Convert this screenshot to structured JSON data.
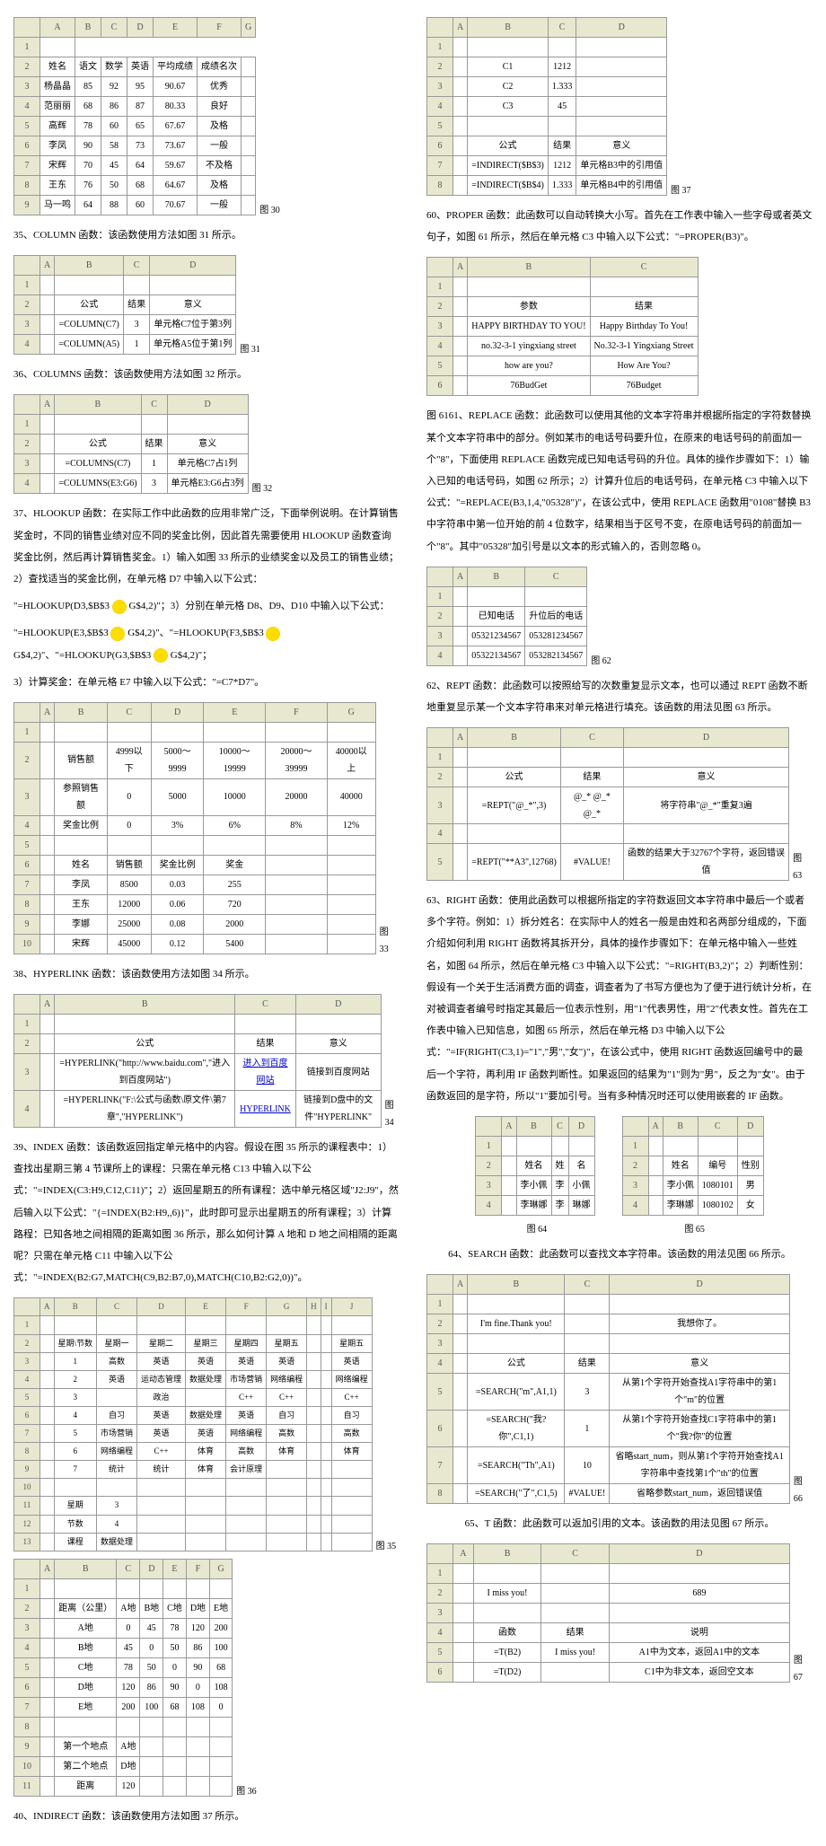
{
  "left": {
    "fig30": {
      "cols": [
        "",
        "A",
        "B",
        "C",
        "D",
        "E",
        "F",
        "G"
      ],
      "rows": [
        [
          "1",
          ""
        ],
        [
          "2",
          "姓名",
          "语文",
          "数学",
          "英语",
          "平均成绩",
          "成绩名次",
          ""
        ],
        [
          "3",
          "杨晶晶",
          "85",
          "92",
          "95",
          "90.67",
          "优秀",
          ""
        ],
        [
          "4",
          "范丽丽",
          "68",
          "86",
          "87",
          "80.33",
          "良好",
          ""
        ],
        [
          "5",
          "高辉",
          "78",
          "60",
          "65",
          "67.67",
          "及格",
          ""
        ],
        [
          "6",
          "李凤",
          "90",
          "58",
          "73",
          "73.67",
          "一般",
          ""
        ],
        [
          "7",
          "宋辉",
          "70",
          "45",
          "64",
          "59.67",
          "不及格",
          ""
        ],
        [
          "8",
          "王东",
          "76",
          "50",
          "68",
          "64.67",
          "及格",
          ""
        ],
        [
          "9",
          "马一鸣",
          "64",
          "88",
          "60",
          "70.67",
          "一般",
          ""
        ]
      ],
      "label": "图 30"
    },
    "p35": "35、COLUMN 函数：该函数使用方法如图 31 所示。",
    "fig31": {
      "cols": [
        "",
        "A",
        "B",
        "C",
        "D"
      ],
      "rows": [
        [
          "1",
          "",
          "",
          "",
          ""
        ],
        [
          "2",
          "",
          "公式",
          "结果",
          "意义"
        ],
        [
          "3",
          "",
          "=COLUMN(C7)",
          "3",
          "单元格C7位于第3列"
        ],
        [
          "4",
          "",
          "=COLUMN(A5)",
          "1",
          "单元格A5位于第1列"
        ]
      ],
      "label": "图 31"
    },
    "p36": "36、COLUMNS 函数：该函数使用方法如图 32 所示。",
    "fig32": {
      "cols": [
        "",
        "A",
        "B",
        "C",
        "D"
      ],
      "rows": [
        [
          "1",
          "",
          "",
          "",
          ""
        ],
        [
          "2",
          "",
          "公式",
          "结果",
          "意义"
        ],
        [
          "3",
          "",
          "=COLUMNS(C7)",
          "1",
          "单元格C7占1列"
        ],
        [
          "4",
          "",
          "=COLUMNS(E3:G6)",
          "3",
          "单元格E3:G6占3列"
        ]
      ],
      "label": "图 32"
    },
    "p37": "37、HLOOKUP 函数：在实际工作中此函数的应用非常广泛，下面举例说明。在计算销售奖金时，不同的销售业绩对应不同的奖金比例，因此首先需要使用 HLOOKUP 函数查询奖金比例，然后再计算销售奖金。1）输入如图 33 所示的业绩奖金以及员工的销售业绩；2）查找适当的奖金比例，在单元格 D7 中输入以下公式：",
    "p37a": "\"=HLOOKUP(D3,$B$3",
    "p37b": "G$4,2)\"；3）分别在单元格 D8、D9、D10 中输入以下公式：",
    "p37c": "\"=HLOOKUP(E3,$B$3",
    "p37d": "G$4,2)\"、\"=HLOOKUP(F3,$B$3",
    "p37e": "G$4,2)\"、\"=HLOOKUP(G3,$B$3",
    "p37f": "G$4,2)\"；",
    "p37g": "3）计算奖金：在单元格 E7 中输入以下公式：\"=C7*D7\"。",
    "fig33": {
      "cols": [
        "",
        "A",
        "B",
        "C",
        "D",
        "E",
        "F",
        "G"
      ],
      "rows": [
        [
          "1",
          "",
          "",
          "",
          "",
          "",
          "",
          ""
        ],
        [
          "2",
          "",
          "销售额",
          "4999以下",
          "5000～9999",
          "10000～19999",
          "20000～39999",
          "40000以上"
        ],
        [
          "3",
          "",
          "参照销售额",
          "0",
          "5000",
          "10000",
          "20000",
          "40000"
        ],
        [
          "4",
          "",
          "奖金比例",
          "0",
          "3%",
          "6%",
          "8%",
          "12%"
        ],
        [
          "5",
          "",
          "",
          "",
          "",
          "",
          "",
          ""
        ],
        [
          "6",
          "",
          "姓名",
          "销售额",
          "奖金比例",
          "奖金",
          "",
          ""
        ],
        [
          "7",
          "",
          "李凤",
          "8500",
          "0.03",
          "255",
          "",
          ""
        ],
        [
          "8",
          "",
          "王东",
          "12000",
          "0.06",
          "720",
          "",
          ""
        ],
        [
          "9",
          "",
          "李娜",
          "25000",
          "0.08",
          "2000",
          "",
          ""
        ],
        [
          "10",
          "",
          "宋辉",
          "45000",
          "0.12",
          "5400",
          "",
          ""
        ]
      ],
      "label": "图 33"
    },
    "p38": "38、HYPERLINK 函数：该函数使用方法如图 34 所示。",
    "fig34": {
      "cols": [
        "",
        "A",
        "B",
        "C",
        "D"
      ],
      "rows": [
        [
          "1",
          "",
          "",
          "",
          ""
        ],
        [
          "2",
          "",
          "公式",
          "结果",
          "意义"
        ],
        [
          "3",
          "",
          "=HYPERLINK(\"http://www.baidu.com\",\"进入到百度网站\")",
          "进入到百度网站",
          "链接到百度网站"
        ],
        [
          "4",
          "",
          "=HYPERLINK(\"F:\\公式与函数\\原文件\\第7章\",\"HYPERLINK\")",
          "HYPERLINK",
          "链接到D盘中的文件\"HYPERLINK\""
        ]
      ],
      "label": "图 34"
    },
    "p39": "39、INDEX 函数：该函数返回指定单元格中的内容。假设在图 35 所示的课程表中：1）查找出星期三第 4 节课所上的课程：只需在单元格 C13 中输入以下公式：\"=INDEX(C3:H9,C12,C11)\"；2）返回星期五的所有课程：选中单元格区域\"J2:J9\"，然后输入以下公式：\"{=INDEX(B2:H9,,6)}\"，此时即可显示出星期五的所有课程；3）计算路程：已知各地之间相隔的距离如图 36 所示，那么如何计算 A 地和 D 地之间相隔的距离呢？只需在单元格 C11 中输入以下公式：\"=INDEX(B2:G7,MATCH(C9,B2:B7,0),MATCH(C10,B2:G2,0))\"。",
    "fig35": {
      "cols": [
        "",
        "A",
        "B",
        "C",
        "D",
        "E",
        "F",
        "G",
        "H",
        "I",
        "J"
      ],
      "rows": [
        [
          "1",
          "",
          "",
          "",
          "",
          "",
          "",
          "",
          "",
          "",
          ""
        ],
        [
          "2",
          "",
          "星期\\节数",
          "星期一",
          "星期二",
          "星期三",
          "星期四",
          "星期五",
          "",
          "",
          "星期五"
        ],
        [
          "3",
          "",
          "1",
          "高数",
          "英语",
          "英语",
          "英语",
          "英语",
          "",
          "",
          "英语"
        ],
        [
          "4",
          "",
          "2",
          "英语",
          "运动态管理",
          "数据处理",
          "市场营销",
          "网络编程",
          "",
          "",
          "网络编程"
        ],
        [
          "5",
          "",
          "3",
          "",
          "政治",
          "",
          "C++",
          "C++",
          "",
          "",
          "C++"
        ],
        [
          "6",
          "",
          "4",
          "自习",
          "英语",
          "数据处理",
          "英语",
          "自习",
          "",
          "",
          "自习"
        ],
        [
          "7",
          "",
          "5",
          "市场营销",
          "英语",
          "英语",
          "网络编程",
          "高数",
          "",
          "",
          "高数"
        ],
        [
          "8",
          "",
          "6",
          "网络编程",
          "C++",
          "体育",
          "高数",
          "体育",
          "",
          "",
          "体育"
        ],
        [
          "9",
          "",
          "7",
          "统计",
          "统计",
          "体育",
          "会计原理",
          "",
          "",
          "",
          ""
        ],
        [
          "10",
          "",
          "",
          "",
          "",
          "",
          "",
          "",
          "",
          "",
          ""
        ],
        [
          "11",
          "",
          "星期",
          "3",
          "",
          "",
          "",
          "",
          "",
          "",
          ""
        ],
        [
          "12",
          "",
          "节数",
          "4",
          "",
          "",
          "",
          "",
          "",
          "",
          ""
        ],
        [
          "13",
          "",
          "课程",
          "数据处理",
          "",
          "",
          "",
          "",
          "",
          "",
          ""
        ]
      ],
      "label": "图 35"
    },
    "fig36": {
      "cols": [
        "",
        "A",
        "B",
        "C",
        "D",
        "E",
        "F",
        "G"
      ],
      "rows": [
        [
          "1",
          "",
          "",
          "",
          "",
          "",
          "",
          ""
        ],
        [
          "2",
          "",
          "距离（公里）",
          "A地",
          "B地",
          "C地",
          "D地",
          "E地"
        ],
        [
          "3",
          "",
          "A地",
          "0",
          "45",
          "78",
          "120",
          "200"
        ],
        [
          "4",
          "",
          "B地",
          "45",
          "0",
          "50",
          "86",
          "100"
        ],
        [
          "5",
          "",
          "C地",
          "78",
          "50",
          "0",
          "90",
          "68"
        ],
        [
          "6",
          "",
          "D地",
          "120",
          "86",
          "90",
          "0",
          "108"
        ],
        [
          "7",
          "",
          "E地",
          "200",
          "100",
          "68",
          "108",
          "0"
        ],
        [
          "8",
          "",
          "",
          "",
          "",
          "",
          "",
          ""
        ],
        [
          "9",
          "",
          "第一个地点",
          "A地",
          "",
          "",
          "",
          ""
        ],
        [
          "10",
          "",
          "第二个地点",
          "D地",
          "",
          "",
          "",
          ""
        ],
        [
          "11",
          "",
          "距离",
          "120",
          "",
          "",
          "",
          ""
        ]
      ],
      "label": "图 36"
    },
    "p40": "40、INDIRECT 函数：该函数使用方法如图 37 所示。"
  },
  "right": {
    "fig37": {
      "cols": [
        "",
        "A",
        "B",
        "C",
        "D"
      ],
      "rows": [
        [
          "1",
          "",
          "",
          "",
          ""
        ],
        [
          "2",
          "",
          "C1",
          "1212",
          ""
        ],
        [
          "3",
          "",
          "C2",
          "1.333",
          ""
        ],
        [
          "4",
          "",
          "C3",
          "45",
          ""
        ],
        [
          "5",
          "",
          "",
          "",
          ""
        ],
        [
          "6",
          "",
          "公式",
          "结果",
          "意义"
        ],
        [
          "7",
          "",
          "=INDIRECT($B$3)",
          "1212",
          "单元格B3中的引用值"
        ],
        [
          "8",
          "",
          "=INDIRECT($B$4)",
          "1.333",
          "单元格B4中的引用值"
        ]
      ],
      "label": "图 37"
    },
    "p60": "60、PROPER 函数：此函数可以自动转换大小写。首先在工作表中输入一些字母或者英文句子，如图 61 所示，然后在单元格 C3 中输入以下公式：\"=PROPER(B3)\"。",
    "fig61": {
      "cols": [
        "",
        "A",
        "B",
        "C"
      ],
      "rows": [
        [
          "1",
          "",
          "",
          ""
        ],
        [
          "2",
          "",
          "参数",
          "结果"
        ],
        [
          "3",
          "",
          "HAPPY BIRTHDAY TO YOU!",
          "Happy Birthday To You!"
        ],
        [
          "4",
          "",
          "no.32-3-1 yingxiang street",
          "No.32-3-1 Yingxiang Street"
        ],
        [
          "5",
          "",
          "how are you?",
          "How Are You?"
        ],
        [
          "6",
          "",
          "76BudGet",
          "76Budget"
        ]
      ],
      "label": ""
    },
    "p61": "图 6161、REPLACE 函数：此函数可以使用其他的文本字符串并根据所指定的字符数替换某个文本字符串中的部分。例如某市的电话号码要升位，在原来的电话号码的前面加一个\"8\"，下面使用 REPLACE 函数完成已知电话号码的升位。具体的操作步骤如下：1）输入已知的电话号码，如图 62 所示；2）计算升位后的电话号码，在单元格 C3 中输入以下公式：\"=REPLACE(B3,1,4,\"05328\")\"，在该公式中，使用 REPLACE 函数用\"0108\"替换 B3 中字符串中第一位开始的前 4 位数字，结果相当于区号不变，在原电话号码的前面加一个\"8\"。其中\"05328\"加引号是以文本的形式输入的，否则忽略 0。",
    "fig62": {
      "cols": [
        "",
        "A",
        "B",
        "C"
      ],
      "rows": [
        [
          "1",
          "",
          "",
          ""
        ],
        [
          "2",
          "",
          "已知电话",
          "升位后的电话"
        ],
        [
          "3",
          "",
          "05321234567",
          "053281234567"
        ],
        [
          "4",
          "",
          "05322134567",
          "053282134567"
        ]
      ],
      "label": "图 62"
    },
    "p62": "62、REPT 函数：此函数可以按照给写的次数重复显示文本，也可以通过 REPT 函数不断地重复显示某一个文本字符串来对单元格进行填充。该函数的用法见图 63 所示。",
    "fig63": {
      "cols": [
        "",
        "A",
        "B",
        "C",
        "D"
      ],
      "rows": [
        [
          "1",
          "",
          "",
          "",
          ""
        ],
        [
          "2",
          "",
          "公式",
          "结果",
          "意义"
        ],
        [
          "3",
          "",
          "=REPT(\"@_*\",3)",
          "@_* @_* @_*",
          "将字符串\"@_*\"重复3遍"
        ],
        [
          "4",
          "",
          "",
          "",
          ""
        ],
        [
          "5",
          "",
          "=REPT(\"**A3\",12768)",
          "#VALUE!",
          "函数的结果大于32767个字符，返回错误值"
        ]
      ],
      "label": "图 63"
    },
    "p63": "63、RIGHT 函数：使用此函数可以根据所指定的字符数返回文本字符串中最后一个或者多个字符。例如：1）拆分姓名：在实际中人的姓名一般是由姓和名两部分组成的，下面介绍如何利用 RIGHT 函数将其拆开分，具体的操作步骤如下：在单元格中输入一些姓名，如图 64 所示，然后在单元格 C3 中输入以下公式：\"=RIGHT(B3,2)\"；2）判断性别：假设有一个关于生活消费方面的调查，调查者为了书写方便也为了便于进行统计分析，在对被调查者编号时指定其最后一位表示性别，用\"1\"代表男性，用\"2\"代表女性。首先在工作表中输入已知信息，如图 65 所示，然后在单元格 D3 中输入以下公式：\"=IF(RIGHT(C3,1)=\"1\",\"男\",\"女\")\"，在该公式中，使用 RIGHT 函数返回编号中的最后一个字符，再利用 IF 函数判断性。如果返回的结果为\"1\"则为\"男\"，反之为\"女\"。由于函数返回的是字符，所以\"1\"要加引号。当有多种情况时还可以使用嵌套的 IF 函数。",
    "fig64": {
      "cols": [
        "",
        "A",
        "B",
        "C",
        "D"
      ],
      "rows": [
        [
          "1",
          "",
          "",
          "",
          ""
        ],
        [
          "2",
          "",
          "姓名",
          "姓",
          "名"
        ],
        [
          "3",
          "",
          "李小佩",
          "李",
          "小佩"
        ],
        [
          "4",
          "",
          "李琳娜",
          "李",
          "琳娜"
        ]
      ],
      "label": "图 64"
    },
    "fig65": {
      "cols": [
        "",
        "A",
        "B",
        "C",
        "D"
      ],
      "rows": [
        [
          "1",
          "",
          "",
          "",
          ""
        ],
        [
          "2",
          "",
          "姓名",
          "编号",
          "性别"
        ],
        [
          "3",
          "",
          "李小佩",
          "1080101",
          "男"
        ],
        [
          "4",
          "",
          "李琳娜",
          "1080102",
          "女"
        ]
      ],
      "label": "图 65"
    },
    "p64": "64、SEARCH 函数：此函数可以查找文本字符串。该函数的用法见图 66 所示。",
    "fig66": {
      "cols": [
        "",
        "A",
        "B",
        "C",
        "D"
      ],
      "rows": [
        [
          "1",
          "",
          "",
          "",
          ""
        ],
        [
          "2",
          "",
          "I'm fine.Thank you!",
          "",
          "我想你了。"
        ],
        [
          "3",
          "",
          "",
          "",
          ""
        ],
        [
          "4",
          "",
          "公式",
          "结果",
          "意义"
        ],
        [
          "5",
          "",
          "=SEARCH(\"m\",A1,1)",
          "3",
          "从第1个字符开始查找A1字符串中的第1个\"m\"的位置"
        ],
        [
          "6",
          "",
          "=SEARCH(\"我?你\",C1,1)",
          "1",
          "从第1个字符开始查找C1字符串中的第1个\"我?你\"的位置"
        ],
        [
          "7",
          "",
          "=SEARCH(\"Th\",A1)",
          "10",
          "省略start_num，则从第1个字符开始查找A1字符串中查找第1个\"th\"的位置"
        ],
        [
          "8",
          "",
          "=SEARCH(\"了\",C1,5)",
          "#VALUE!",
          "省略参数start_num，返回错误值"
        ]
      ],
      "label": "图 66"
    },
    "p65": "65、T 函数：此函数可以返加引用的文本。该函数的用法见图 67 所示。",
    "fig67": {
      "cols": [
        "",
        "A",
        "B",
        "C",
        "D"
      ],
      "rows": [
        [
          "1",
          "",
          "",
          "",
          ""
        ],
        [
          "2",
          "",
          "I miss you!",
          "",
          "689"
        ],
        [
          "3",
          "",
          "",
          "",
          ""
        ],
        [
          "4",
          "",
          "函数",
          "结果",
          "说明"
        ],
        [
          "5",
          "",
          "=T(B2)",
          "I miss you!",
          "A1中为文本，返回A1中的文本"
        ],
        [
          "6",
          "",
          "=T(D2)",
          "",
          "C1中为非文本，返回空文本"
        ]
      ],
      "label": "图 67"
    }
  }
}
